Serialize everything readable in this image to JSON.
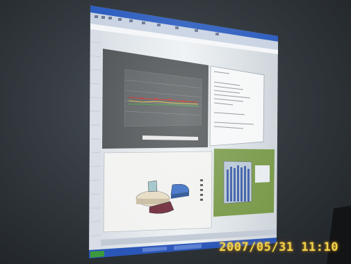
{
  "photo": {
    "subject": "projected spreadsheet with charts",
    "colors": {
      "wall": "#30363b",
      "projection": "#e9edf0",
      "titlebar": "#2f5fc0",
      "taskbar": "#2a56b8",
      "chart_dark": "#505456",
      "chart_green": "#7a9a4a",
      "pie_blue": "#3d6fc4",
      "pie_maroon": "#6e2a3a",
      "pie_cream": "#e6dcc4",
      "stamp": "#f0d24a"
    },
    "icons": [
      "start-button-icon",
      "taskbar-app-icon"
    ]
  },
  "timestamp": {
    "text": "2007/05/31  11:10"
  }
}
